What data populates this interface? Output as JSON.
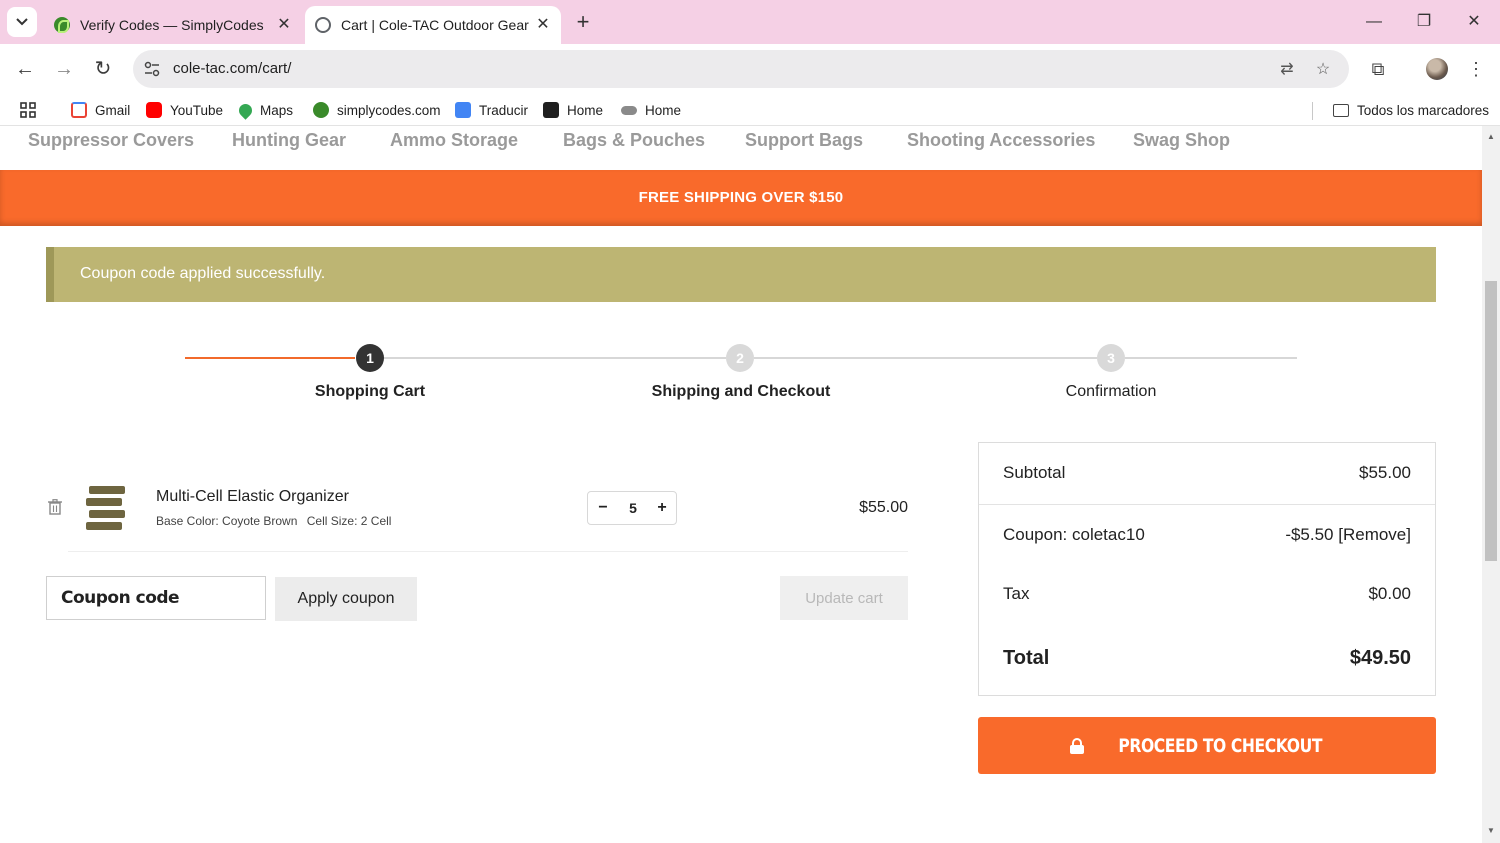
{
  "browser": {
    "tabs": [
      {
        "title": "Verify Codes — SimplyCodes",
        "active": false
      },
      {
        "title": "Cart | Cole-TAC Outdoor Gear",
        "active": true
      }
    ],
    "url": "cole-tac.com/cart/",
    "bookmarks": [
      {
        "label": "Gmail",
        "icon": "gmail-icon",
        "color": "#ea4335"
      },
      {
        "label": "YouTube",
        "icon": "youtube-icon",
        "color": "#ff0000"
      },
      {
        "label": "Maps",
        "icon": "maps-icon",
        "color": "#34a853"
      },
      {
        "label": "simplycodes.com",
        "icon": "simplycodes-icon",
        "color": "#3a8a2a"
      },
      {
        "label": "Traducir",
        "icon": "translate-icon",
        "color": "#4285f4"
      },
      {
        "label": "Home",
        "icon": "xbox-icon",
        "color": "#1f1f1f"
      },
      {
        "label": "Home",
        "icon": "cloud-icon",
        "color": "#555555"
      }
    ],
    "all_bookmarks_label": "Todos los marcadores"
  },
  "nav": {
    "categories": [
      "Suppressor Covers",
      "Hunting Gear",
      "Ammo Storage",
      "Bags & Pouches",
      "Support Bags",
      "Shooting Accessories",
      "Swag Shop"
    ]
  },
  "banner": {
    "text": "FREE SHIPPING OVER $150",
    "color": "#f96a2b"
  },
  "notice": {
    "text": "Coupon code applied successfully.",
    "color": "#bdb573"
  },
  "steps": [
    {
      "number": "1",
      "label": "Shopping Cart",
      "state": "active"
    },
    {
      "number": "2",
      "label": "Shipping and Checkout",
      "state": "pending"
    },
    {
      "number": "3",
      "label": "Confirmation",
      "state": "pending"
    }
  ],
  "cart": {
    "items": [
      {
        "name": "Multi-Cell Elastic Organizer",
        "base_color": "Base Color: Coyote Brown",
        "cell_size": "Cell Size: 2 Cell",
        "quantity": "5",
        "price": "$55.00"
      }
    ],
    "coupon_placeholder": "Coupon code",
    "apply_coupon_label": "Apply coupon",
    "update_cart_label": "Update cart"
  },
  "totals": {
    "subtotal_label": "Subtotal",
    "subtotal": "$55.00",
    "coupon_label": "Coupon: coletac10",
    "coupon_value": "-$5.50 [Remove]",
    "tax_label": "Tax",
    "tax": "$0.00",
    "total_label": "Total",
    "total": "$49.50"
  },
  "checkout_label": "PROCEED TO CHECKOUT",
  "colors": {
    "accent": "#f96a2b",
    "notice": "#bdb573",
    "step_active": "#333333"
  }
}
